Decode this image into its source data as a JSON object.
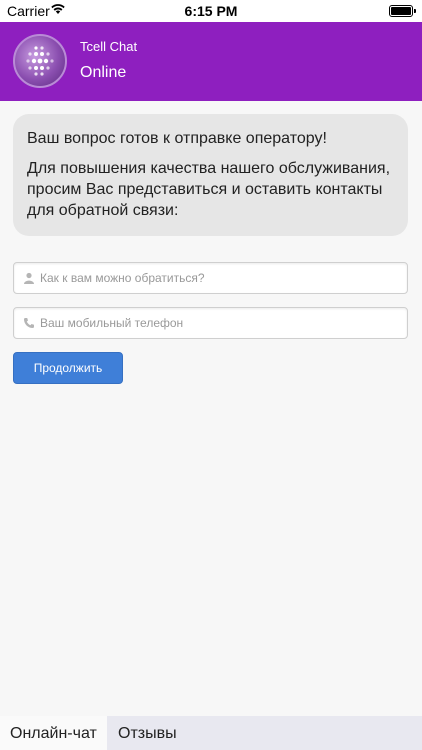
{
  "status_bar": {
    "carrier": "Carrier",
    "time": "6:15 PM"
  },
  "header": {
    "title": "Tcell Chat",
    "status": "Online"
  },
  "bubble": {
    "line1": "Ваш вопрос готов к отправке оператору!",
    "line2": "Для повышения качества нашего обслуживания, просим Вас представиться и оставить контакты для обратной связи:"
  },
  "form": {
    "name_placeholder": "Как к вам можно обратиться?",
    "name_value": "",
    "phone_placeholder": "Ваш мобильный телефон",
    "phone_value": "",
    "submit_label": "Продолжить"
  },
  "tabs": [
    {
      "label": "Онлайн-чат",
      "active": true
    },
    {
      "label": "Отзывы",
      "active": false
    }
  ],
  "colors": {
    "header_bg": "#8e1fbf",
    "button_bg": "#3f7fd8",
    "bubble_bg": "#e6e6e6"
  }
}
